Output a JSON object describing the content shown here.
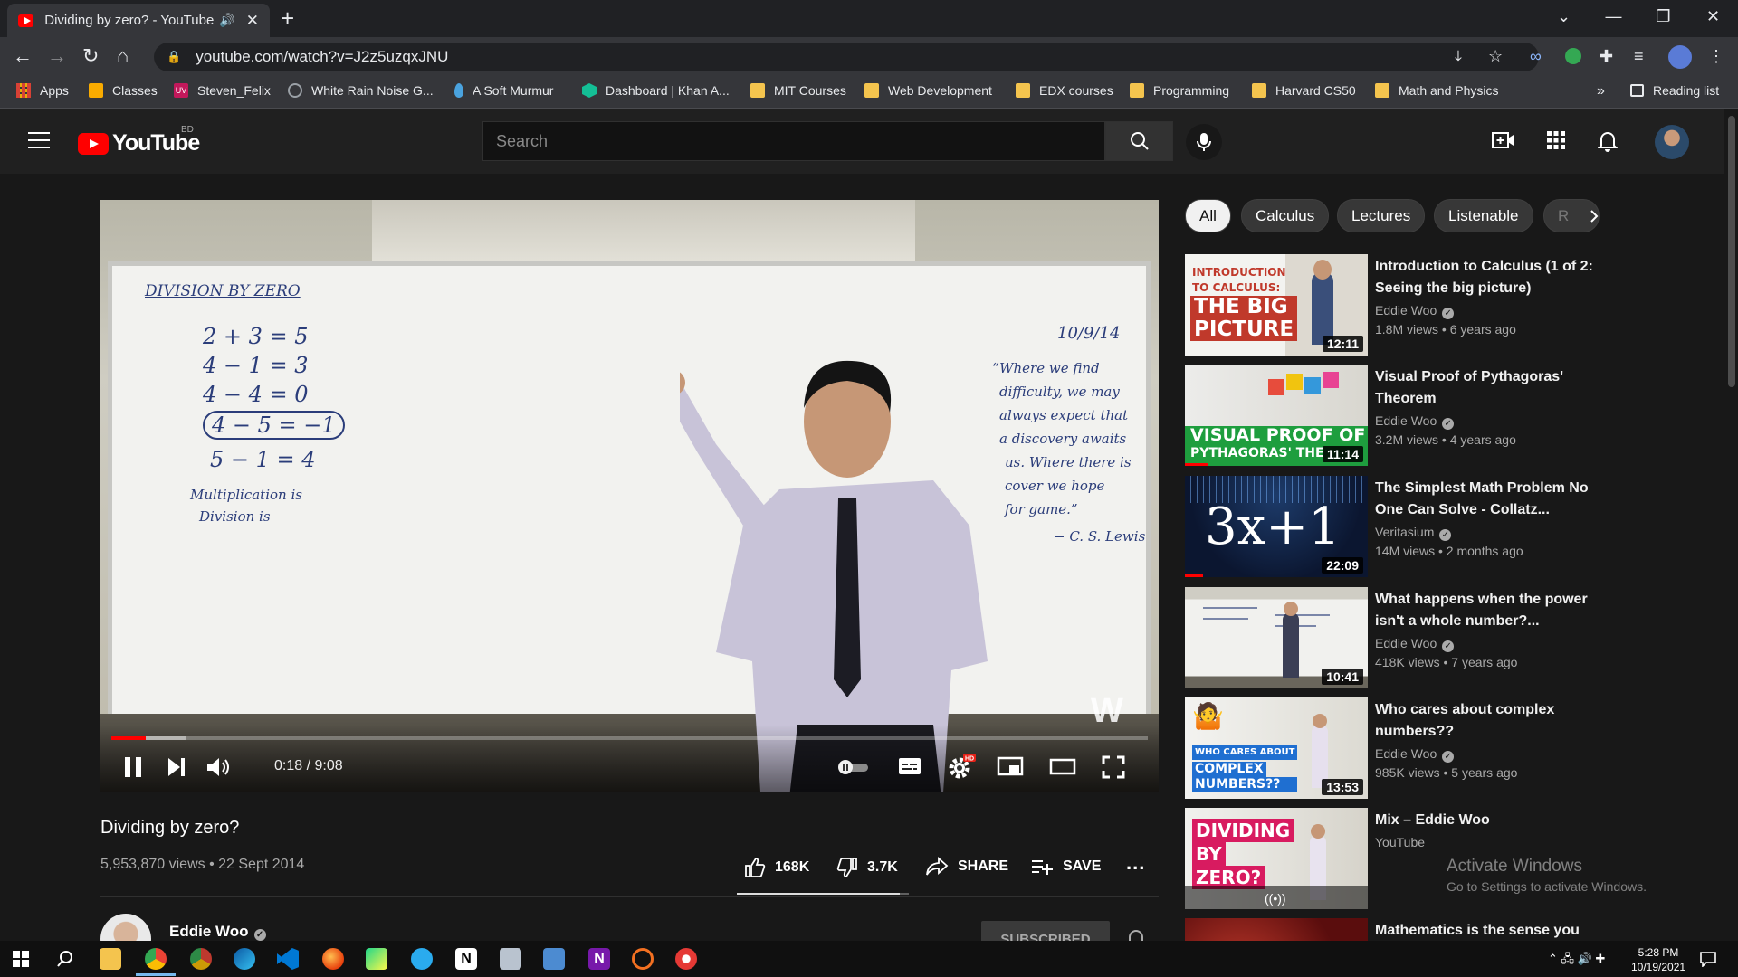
{
  "browser": {
    "tab_title": "Dividing by zero? - YouTube",
    "url": "youtube.com/watch?v=J2z5uzqxJNU",
    "bookmarks": [
      {
        "label": "Apps",
        "icon": "apps-grid-icon"
      },
      {
        "label": "Classes",
        "icon": "classroom-icon"
      },
      {
        "label": "Steven_Felix",
        "icon": "uva-icon"
      },
      {
        "label": "White Rain Noise G...",
        "icon": "globe-icon"
      },
      {
        "label": "A Soft Murmur",
        "icon": "drop-icon"
      },
      {
        "label": "Dashboard | Khan A...",
        "icon": "khan-icon"
      },
      {
        "label": "MIT Courses",
        "icon": "folder-icon"
      },
      {
        "label": "Web Development",
        "icon": "folder-icon"
      },
      {
        "label": "EDX courses",
        "icon": "folder-icon"
      },
      {
        "label": "Programming",
        "icon": "folder-icon"
      },
      {
        "label": "Harvard CS50",
        "icon": "folder-icon"
      },
      {
        "label": "Math and Physics",
        "icon": "folder-icon"
      }
    ],
    "overflow": "»",
    "reading_list": "Reading list"
  },
  "youtube": {
    "logo_text": "YouTube",
    "country_code": "BD",
    "search_placeholder": "Search"
  },
  "video": {
    "title": "Dividing by zero?",
    "views_date": "5,953,870 views • 22 Sept 2014",
    "time": "0:18 / 9:08",
    "progress_fraction": 0.033,
    "buffered_fraction": 0.072,
    "watermark": "W",
    "likes": "168K",
    "dislikes": "3.7K",
    "share": "SHARE",
    "save": "SAVE",
    "more": "...",
    "channel": "Eddie Woo",
    "subscribe": "SUBSCRIBED",
    "whiteboard": {
      "heading": "DIVISION BY ZERO",
      "lines": [
        "2 + 3 = 5",
        "4 − 1 = 3",
        "4 − 4 = 0",
        "4 − 5 = −1",
        "5 − 1 = 4"
      ],
      "lower": [
        "Multiplication is",
        "Division is"
      ],
      "date": "10/9/14",
      "quote": [
        "“Where we find",
        "difficulty, we may",
        "always expect that",
        "a discovery awaits",
        "us. Where there is",
        "cover we hope",
        "for game.”",
        "− C. S. Lewis"
      ]
    }
  },
  "chips": [
    "All",
    "Calculus",
    "Lectures",
    "Listenable",
    "R"
  ],
  "recommendations": [
    {
      "title": "Introduction to Calculus (1 of 2: Seeing the big picture)",
      "channel": "Eddie Woo",
      "verified": true,
      "meta": "1.8M views • 6 years ago",
      "duration": "12:11",
      "thumb_text": [
        "INTRODUCTION",
        "TO CALCULUS:",
        "THE BIG",
        "PICTURE"
      ]
    },
    {
      "title": "Visual Proof of Pythagoras' Theorem",
      "channel": "Eddie Woo",
      "verified": true,
      "meta": "3.2M views • 4 years ago",
      "duration": "11:14",
      "thumb_text": [
        "VISUAL PROOF OF",
        "PYTHAGORAS' THE"
      ]
    },
    {
      "title": "The Simplest Math Problem No One Can Solve - Collatz...",
      "channel": "Veritasium",
      "verified": true,
      "meta": "14M views • 2 months ago",
      "duration": "22:09",
      "thumb_text": [
        "3x+1"
      ]
    },
    {
      "title": "What happens when the power isn't a whole number?...",
      "channel": "Eddie Woo",
      "verified": true,
      "meta": "418K views • 7 years ago",
      "duration": "10:41",
      "thumb_text": []
    },
    {
      "title": "Who cares about complex numbers??",
      "channel": "Eddie Woo",
      "verified": true,
      "meta": "985K views • 5 years ago",
      "duration": "13:53",
      "thumb_text": [
        "WHO CARES ABOUT",
        "COMPLEX",
        "NUMBERS??"
      ]
    },
    {
      "title": "Mix – Eddie Woo",
      "channel": "YouTube",
      "verified": false,
      "meta": "",
      "duration": "",
      "thumb_text": [
        "DIVIDING",
        "BY",
        "ZERO?"
      ]
    },
    {
      "title": "Mathematics is the sense you",
      "channel": "",
      "verified": false,
      "meta": "",
      "duration": "",
      "thumb_text": []
    }
  ],
  "watermark_os": {
    "line1": "Activate Windows",
    "line2": "Go to Settings to activate Windows."
  },
  "taskbar": {
    "time": "5:28 PM",
    "date": "10/19/2021"
  },
  "colors": {
    "brand_red": "#ff0000",
    "page_bg": "#181818",
    "header_bg": "#202020"
  }
}
